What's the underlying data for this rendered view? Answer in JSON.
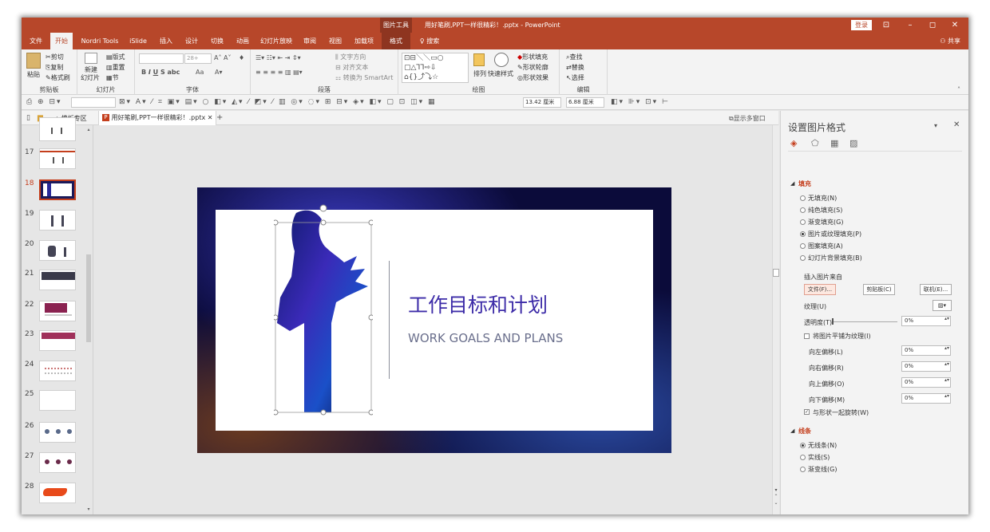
{
  "titlebar": {
    "context_label": "图片工具",
    "title": "用好笔刷,PPT一样很精彩！.pptx - PowerPoint",
    "login": "登录",
    "min": "–",
    "restore": "◻",
    "close": "✕"
  },
  "tabs": [
    "文件",
    "开始",
    "Nordri Tools",
    "iSlide",
    "插入",
    "设计",
    "切换",
    "动画",
    "幻灯片放映",
    "审阅",
    "视图",
    "加载项",
    "格式"
  ],
  "search_label": "搜索",
  "share_label": "共享",
  "ribbon": {
    "clipboard": {
      "paste": "粘贴",
      "cut": "剪切",
      "copy": "复制",
      "format_painter": "格式刷",
      "label": "剪贴板"
    },
    "slides": {
      "new": "新建",
      "new2": "幻灯片",
      "layout": "版式",
      "reset": "重置",
      "section": "节",
      "label": "幻灯片"
    },
    "font": {
      "size": "28+",
      "case": "Aa",
      "label": "字体"
    },
    "paragraph": {
      "text_direction": "文字方向",
      "align_text": "对齐文本",
      "smartart": "转换为 SmartArt",
      "label": "段落"
    },
    "drawing": {
      "arrange": "排列",
      "quick_styles": "快速样式",
      "fill": "形状填充",
      "outline": "形状轮廓",
      "effects": "形状效果",
      "label": "绘图"
    },
    "editing": {
      "find": "查找",
      "replace": "替换",
      "select": "选择",
      "label": "编辑"
    }
  },
  "qat": {
    "width": "13.42 厘米",
    "height": "6.88 厘米"
  },
  "doctabs": {
    "templates": "模板专区",
    "file": "用好笔刷,PPT一样很精彩！.pptx",
    "multi": "显示多窗口"
  },
  "thumbnails": [
    {
      "num": ""
    },
    {
      "num": "17"
    },
    {
      "num": "18"
    },
    {
      "num": "19"
    },
    {
      "num": "20"
    },
    {
      "num": "21"
    },
    {
      "num": "22"
    },
    {
      "num": "23"
    },
    {
      "num": "24"
    },
    {
      "num": "25"
    },
    {
      "num": "26"
    },
    {
      "num": "27"
    },
    {
      "num": "28"
    }
  ],
  "slide": {
    "title": "工作目标和计划",
    "subtitle": "WORK GOALS AND PLANS",
    "colors": {
      "title": "#3d2ca8",
      "subtitle": "#6a6f8c",
      "frame": "#0b0b3a"
    }
  },
  "pane": {
    "title": "设置图片格式",
    "section_fill": "填充",
    "fill_options": [
      "无填充(N)",
      "纯色填充(S)",
      "渐变填充(G)",
      "图片或纹理填充(P)",
      "图案填充(A)",
      "幻灯片背景填充(B)"
    ],
    "insert_from": "插入图片来自",
    "btn_file": "文件(F)...",
    "btn_clipboard": "剪贴板(C)",
    "btn_online": "联机(E)...",
    "texture": "纹理(U)",
    "transparency": "透明度(T)",
    "transparency_val": "0%",
    "tile": "将图片平铺为纹理(I)",
    "offset_left": "向左偏移(L)",
    "offset_right": "向右偏移(R)",
    "offset_top": "向上偏移(O)",
    "offset_bottom": "向下偏移(M)",
    "offset_val": "0%",
    "rotate_with": "与形状一起旋转(W)",
    "section_line": "线条",
    "line_options": [
      "无线条(N)",
      "实线(S)",
      "渐变线(G)"
    ]
  },
  "accent_color": "#b7472a"
}
